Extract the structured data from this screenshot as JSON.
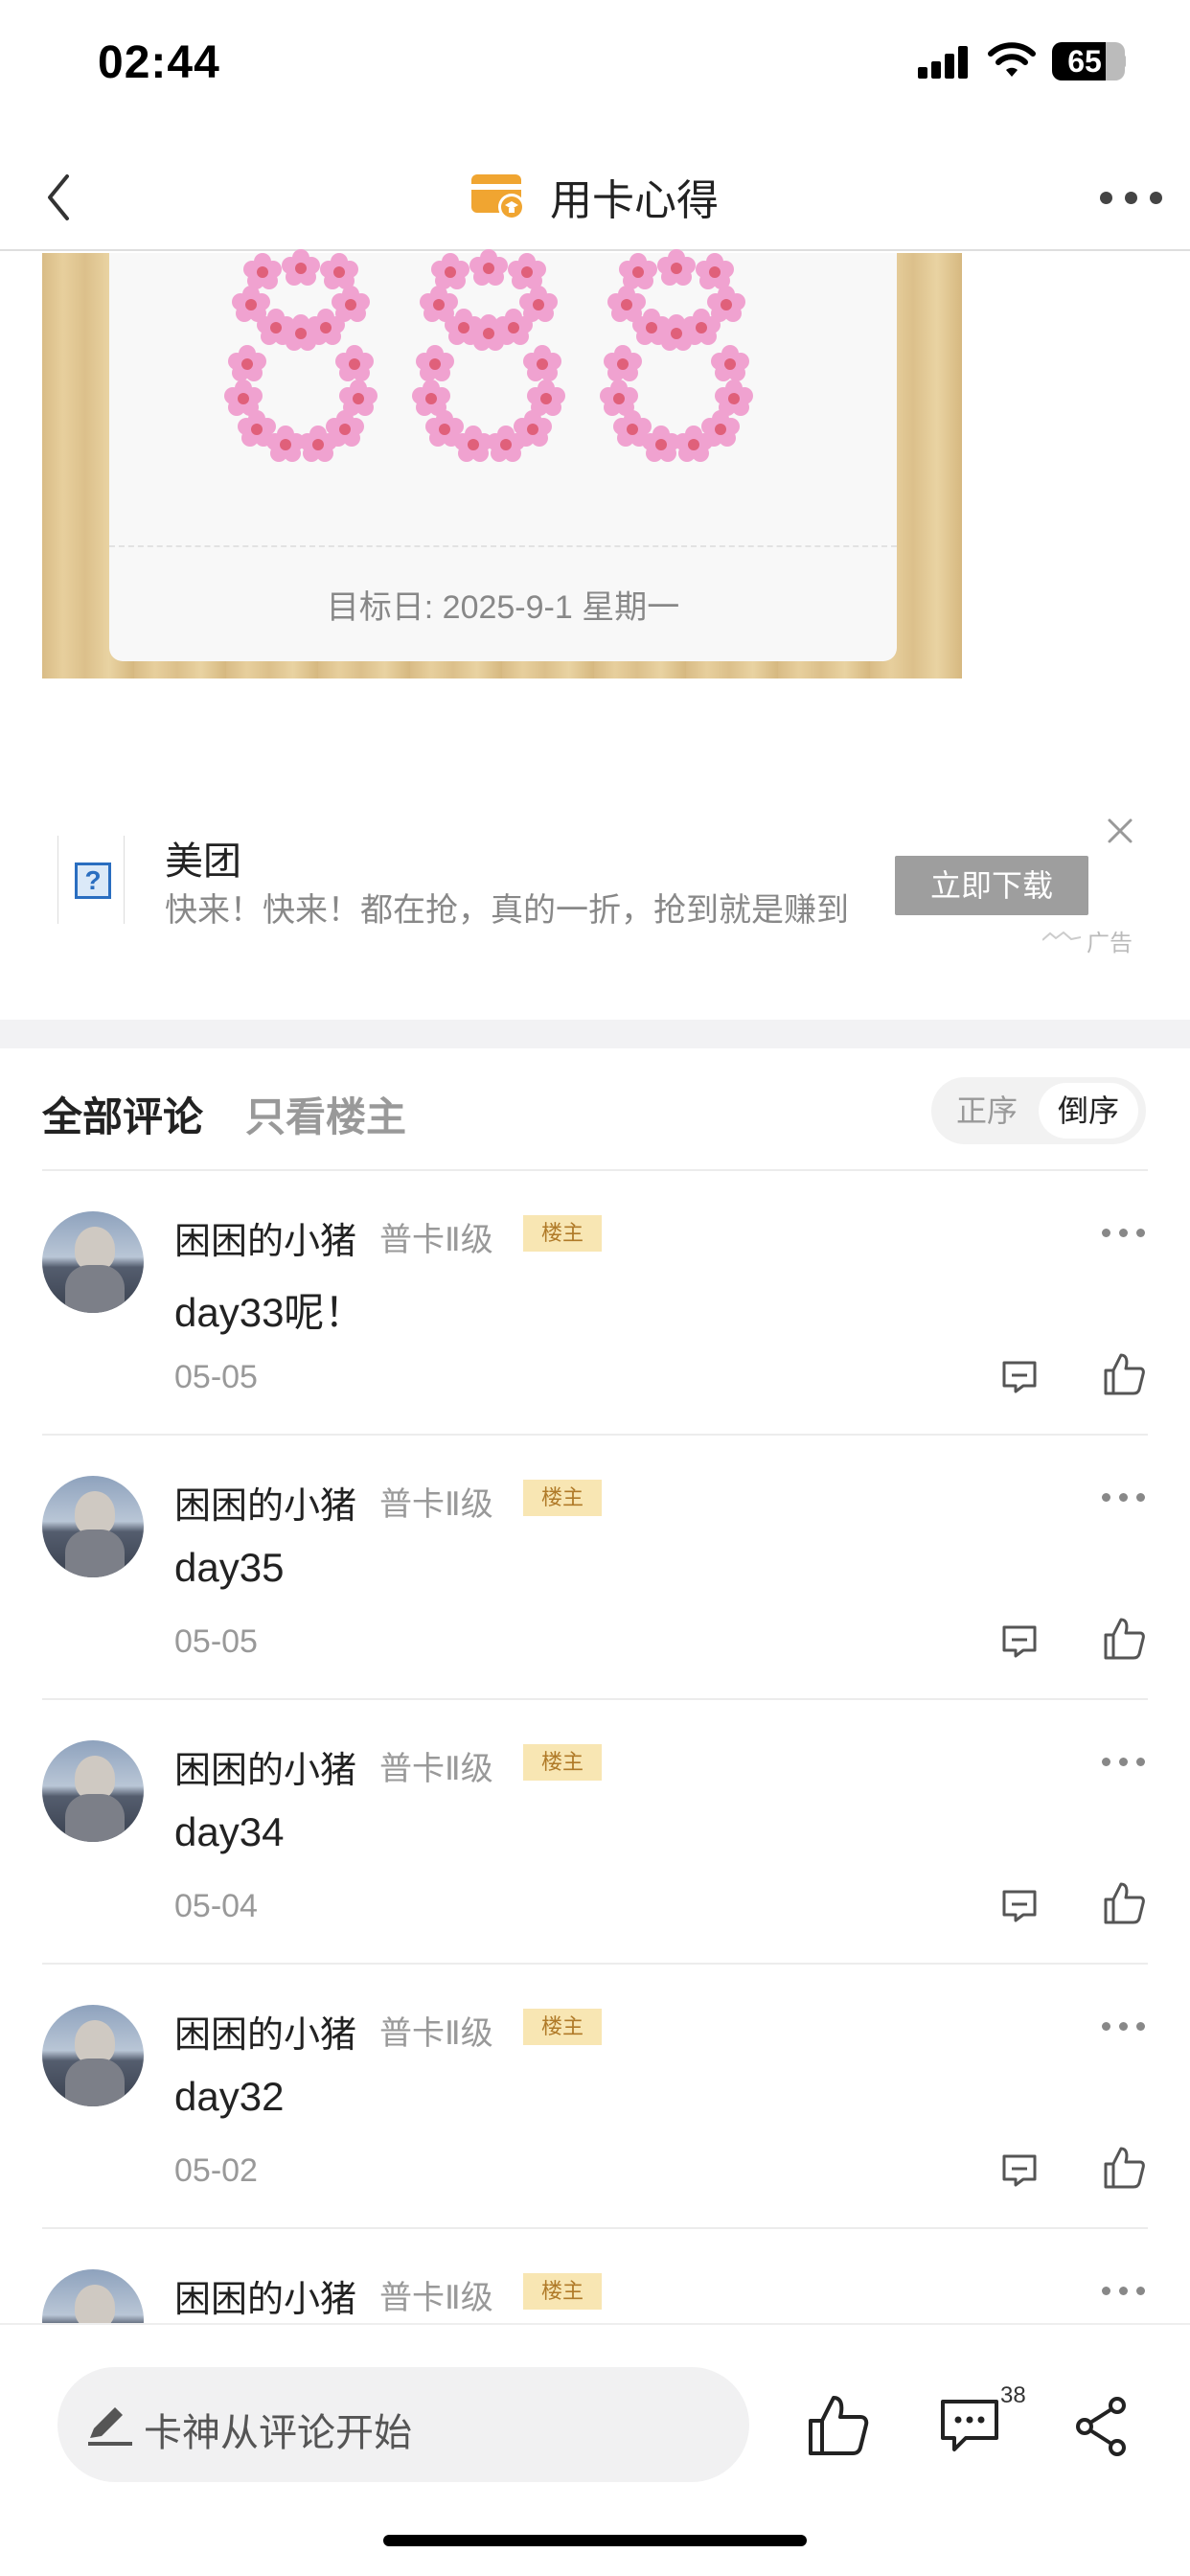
{
  "status_bar": {
    "time": "02:44",
    "battery": "65",
    "icons": [
      "signal-icon",
      "wifi-icon",
      "battery-icon"
    ]
  },
  "nav": {
    "title": "用卡心得",
    "icons": [
      "back-icon",
      "card-graduation-icon",
      "more-icon"
    ],
    "accent_color": "#f0a531"
  },
  "post_image": {
    "digits": "888",
    "target_date": "目标日: 2025-9-1 星期一"
  },
  "ad": {
    "title": "美团",
    "description": "快来！快来！都在抢，真的一折，抢到就是赚到",
    "button": "立即下载",
    "label": "广告"
  },
  "comments_header": {
    "tab_all": "全部评论",
    "tab_owner": "只看楼主",
    "sort_asc": "正序",
    "sort_desc": "倒序",
    "sort_selected": "倒序"
  },
  "comments": [
    {
      "user": "困困的小猪",
      "level": "普卡Ⅱ级",
      "badge": "楼主",
      "text": "day33呢！",
      "date": "05-05"
    },
    {
      "user": "困困的小猪",
      "level": "普卡Ⅱ级",
      "badge": "楼主",
      "text": "day35",
      "date": "05-05"
    },
    {
      "user": "困困的小猪",
      "level": "普卡Ⅱ级",
      "badge": "楼主",
      "text": "day34",
      "date": "05-04"
    },
    {
      "user": "困困的小猪",
      "level": "普卡Ⅱ级",
      "badge": "楼主",
      "text": "day32",
      "date": "05-02"
    },
    {
      "user": "困困的小猪",
      "level": "普卡Ⅱ级",
      "badge": "楼主",
      "text": "",
      "date": ""
    }
  ],
  "bottom_bar": {
    "input_placeholder": "卡神从评论开始",
    "comment_count": "38",
    "icons": [
      "pencil-icon",
      "like-icon",
      "comment-icon",
      "share-icon"
    ]
  }
}
